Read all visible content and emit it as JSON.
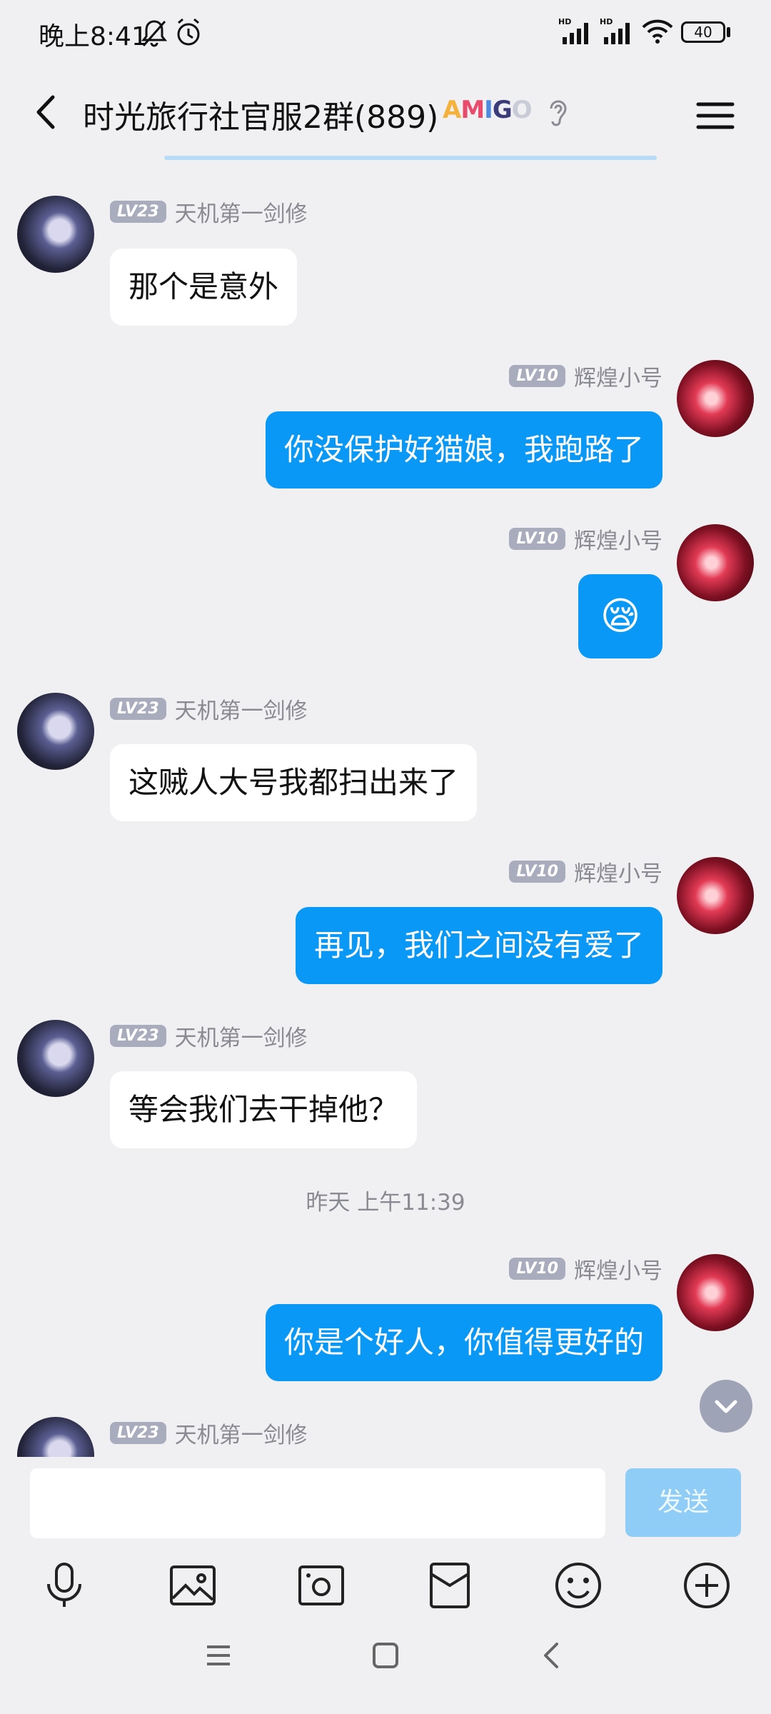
{
  "status_bar": {
    "time": "晚上8:41",
    "battery": "40",
    "icons": [
      "bell-off-icon",
      "alarm-icon",
      "signal-hd-icon",
      "signal-hd-icon",
      "wifi-icon",
      "battery-icon"
    ]
  },
  "header": {
    "title": "时光旅行社官服2群(889)",
    "badge": "AMIGO"
  },
  "messages": [
    {
      "side": "left",
      "level": "LV23",
      "sender": "天机第一剑修",
      "text": "那个是意外"
    },
    {
      "side": "right",
      "level": "LV10",
      "sender": "辉煌小号",
      "text": "你没保护好猫娘，我跑路了"
    },
    {
      "side": "right",
      "level": "LV10",
      "sender": "辉煌小号",
      "emoji": "😪"
    },
    {
      "side": "left",
      "level": "LV23",
      "sender": "天机第一剑修",
      "text": "这贼人大号我都扫出来了"
    },
    {
      "side": "right",
      "level": "LV10",
      "sender": "辉煌小号",
      "text": "再见，我们之间没有爱了"
    },
    {
      "side": "left",
      "level": "LV23",
      "sender": "天机第一剑修",
      "text": "等会我们去干掉他？"
    },
    {
      "side": "right",
      "level": "LV10",
      "sender": "辉煌小号",
      "text": "你是个好人，你值得更好的"
    },
    {
      "side": "left",
      "level": "LV23",
      "sender": "天机第一剑修",
      "text": ""
    }
  ],
  "timestamp": "昨天 上午11:39",
  "input": {
    "value": "",
    "send_label": "发送"
  },
  "colors": {
    "outgoing_bubble": "#0a98f6",
    "incoming_bubble": "#ffffff",
    "send_button": "#8fcdf6",
    "background": "#f0f0f3"
  }
}
